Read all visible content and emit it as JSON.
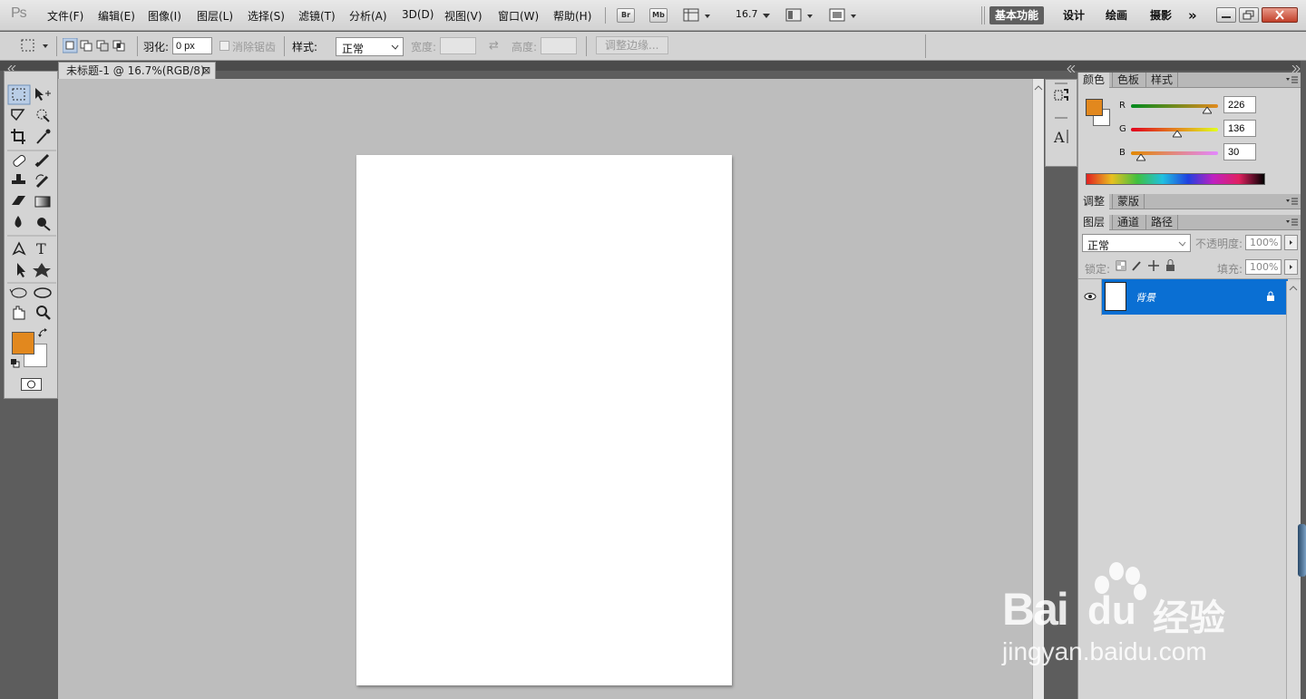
{
  "app": {
    "logo": "Ps"
  },
  "menu": [
    "文件(F)",
    "编辑(E)",
    "图像(I)",
    "图层(L)",
    "选择(S)",
    "滤镜(T)",
    "分析(A)",
    "3D(D)",
    "视图(V)",
    "窗口(W)",
    "帮助(H)"
  ],
  "appbar": {
    "br": "Br",
    "mb": "Mb",
    "zoom": "16.7"
  },
  "workspaces": [
    "基本功能",
    "设计",
    "绘画",
    "摄影"
  ],
  "workspace_more": "»",
  "options": {
    "feather_label": "羽化:",
    "feather_value": "0 px",
    "antialias_label": "消除锯齿",
    "style_label": "样式:",
    "style_value": "正常",
    "width_label": "宽度:",
    "height_label": "高度:",
    "swap_icon": "⇄",
    "refine_edge": "调整边缘..."
  },
  "document": {
    "tab_title": "未标题-1 @ 16.7%(RGB/8)",
    "close": "⊠"
  },
  "color_panel": {
    "tabs": [
      "颜色",
      "色板",
      "样式"
    ],
    "r_label": "R",
    "g_label": "G",
    "b_label": "B",
    "r": "226",
    "g": "136",
    "b": "30",
    "fg_color": "#e2881e"
  },
  "adjust_panel": {
    "tabs": [
      "调整",
      "蒙版"
    ]
  },
  "layers_panel": {
    "tabs": [
      "图层",
      "通道",
      "路径"
    ],
    "blend_mode": "正常",
    "opacity_label": "不透明度:",
    "opacity": "100%",
    "lock_label": "锁定:",
    "fill_label": "填充:",
    "fill": "100%",
    "layers": [
      {
        "name": "背景",
        "visible": true,
        "locked": true,
        "selected": true
      }
    ]
  },
  "watermark": {
    "brand": "Bai",
    "brand2": "du",
    "product": "经验",
    "url": "jingyan.baidu.com"
  }
}
